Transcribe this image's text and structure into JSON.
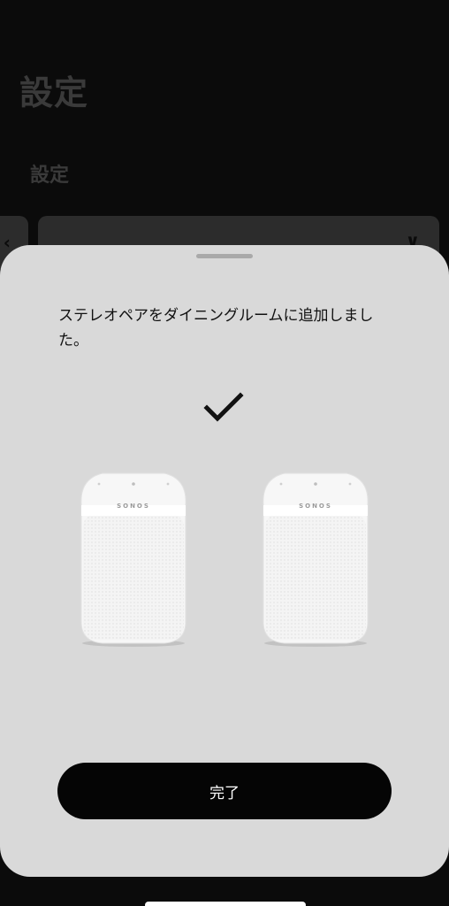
{
  "background": {
    "page_title": "設定",
    "section_title": "設定",
    "left_chevron": "‹",
    "card_chevron": "∨"
  },
  "sheet": {
    "message": "ステレオペアをダイニングルームに追加しました。",
    "success_icon": "checkmark-icon",
    "speakers": [
      {
        "brand": "SONOS"
      },
      {
        "brand": "SONOS"
      }
    ],
    "done_label": "完了"
  },
  "colors": {
    "sheet_background": "#d9d9d9",
    "button_background": "#050505",
    "button_text": "#ffffff",
    "page_background": "#0b0b0b"
  }
}
